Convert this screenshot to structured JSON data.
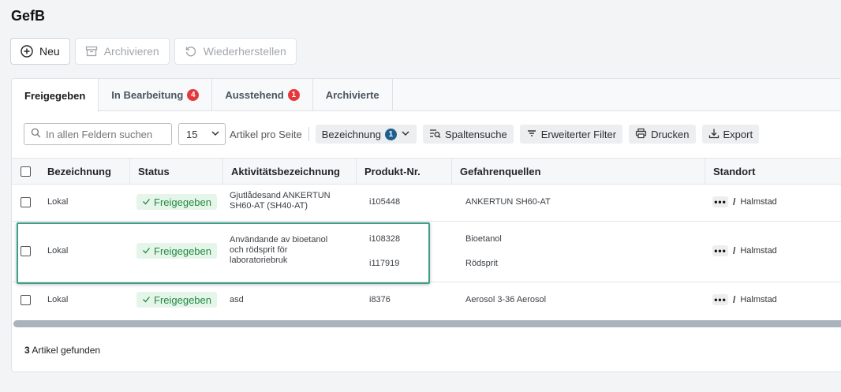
{
  "app": {
    "title": "GefB"
  },
  "toolbar": {
    "new_label": "Neu",
    "archive_label": "Archivieren",
    "restore_label": "Wiederherstellen"
  },
  "tabs": [
    {
      "label": "Freigegeben",
      "badge": null
    },
    {
      "label": "In Bearbeitung",
      "badge": "4"
    },
    {
      "label": "Ausstehend",
      "badge": "1"
    },
    {
      "label": "Archivierte",
      "badge": null
    }
  ],
  "filters": {
    "search_placeholder": "In allen Feldern suchen",
    "page_size": "15",
    "page_size_label": "Artikel pro Seite",
    "group_label": "Bezeichnung",
    "group_count": "1",
    "column_search_label": "Spaltensuche",
    "advanced_filter_label": "Erweiterter Filter",
    "print_label": "Drucken",
    "export_label": "Export"
  },
  "table": {
    "columns": [
      "Bezeichnung",
      "Status",
      "Aktivitätsbezeichnung",
      "Produkt-Nr.",
      "Gefahrenquellen",
      "Standort"
    ],
    "rows": [
      {
        "bezeichnung": "Lokal",
        "status": "Freigegeben",
        "aktivitaet": "Gjutlådesand ANKERTUN SH60-AT (SH40-AT)",
        "produkt_nr": [
          "i105448"
        ],
        "gefahrenquellen": [
          "ANKERTUN SH60-AT"
        ],
        "standort": "Halmstad"
      },
      {
        "bezeichnung": "Lokal",
        "status": "Freigegeben",
        "aktivitaet": "Användande av bioetanol och rödsprit för laboratoriebruk",
        "produkt_nr": [
          "i108328",
          "i117919"
        ],
        "gefahrenquellen": [
          "Bioetanol",
          "Rödsprit"
        ],
        "standort": "Halmstad"
      },
      {
        "bezeichnung": "Lokal",
        "status": "Freigegeben",
        "aktivitaet": "asd",
        "produkt_nr": [
          "i8376"
        ],
        "gefahrenquellen": [
          "Aerosol 3-36 Aerosol"
        ],
        "standort": "Halmstad"
      }
    ]
  },
  "footer": {
    "count": "3",
    "label": "Artikel gefunden"
  },
  "colors": {
    "status_green": "#1f8a3f",
    "badge_red": "#e5383b",
    "highlight": "#3f9e8a"
  }
}
